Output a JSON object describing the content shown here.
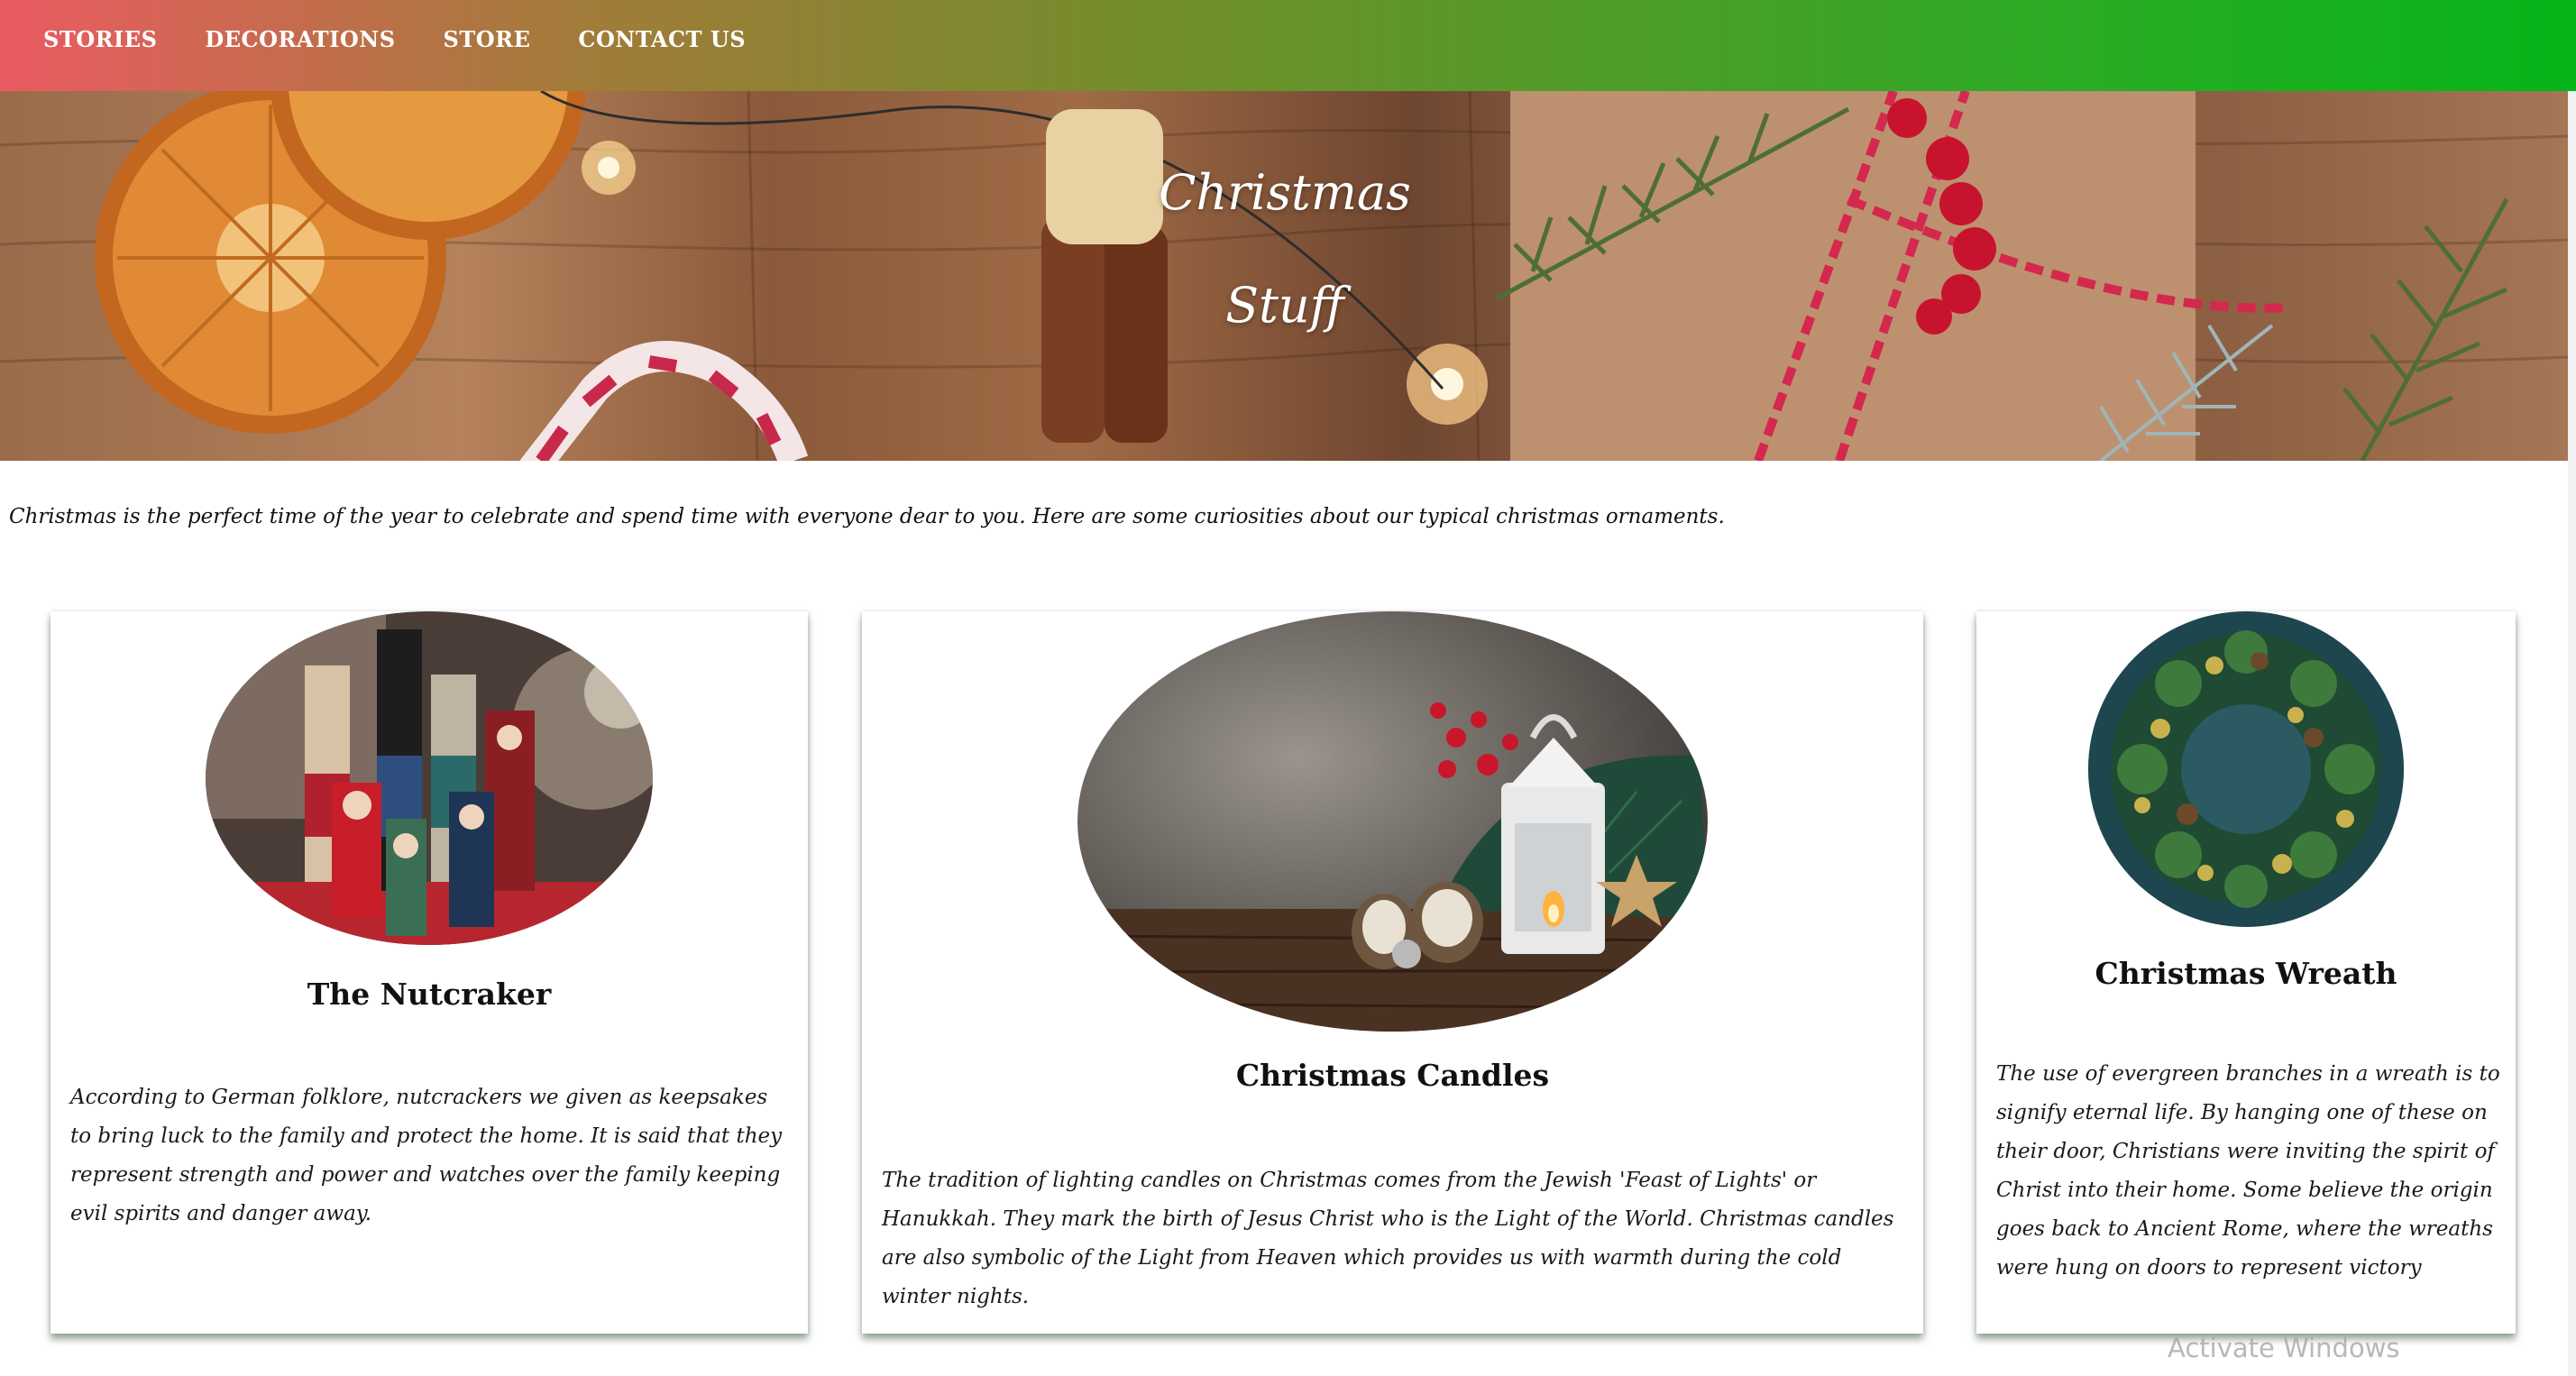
{
  "nav": {
    "items": [
      {
        "label": "STORIES"
      },
      {
        "label": "DECORATIONS"
      },
      {
        "label": "STORE"
      },
      {
        "label": "CONTACT US"
      }
    ]
  },
  "hero": {
    "title_line1": "Christmas",
    "title_line2": "Stuff"
  },
  "intro": {
    "text": "Christmas is the perfect time of the year to celebrate and spend time with everyone dear to you. Here are some curiosities about our typical christmas ornaments."
  },
  "cards": [
    {
      "title": "The Nutcraker",
      "text": "According to German folklore, nutcrackers we given as keepsakes to bring luck to the family and protect the home. It is said that they represent strength and power and watches over the family keeping evil spirits and danger away."
    },
    {
      "title": "Christmas Candles",
      "text": "The tradition of lighting candles on Christmas comes from the Jewish 'Feast of Lights' or Hanukkah. They mark the birth of Jesus Christ who is the Light of the World. Christmas candles are also symbolic of the Light from Heaven which provides us with warmth during the cold winter nights."
    },
    {
      "title": "Christmas Wreath",
      "text": "The use of evergreen branches in a wreath is to signify eternal life. By hanging one of these on their door, Christians were inviting the spirit of Christ into their home. Some believe the origin goes back to Ancient Rome, where the wreaths were hung on doors to represent victory"
    }
  ],
  "os_watermark": "Activate Windows",
  "colors": {
    "nav_gradient_start": "#ea5b62",
    "nav_gradient_end": "#05b51a",
    "card_shadow": "#3c5a3c"
  }
}
